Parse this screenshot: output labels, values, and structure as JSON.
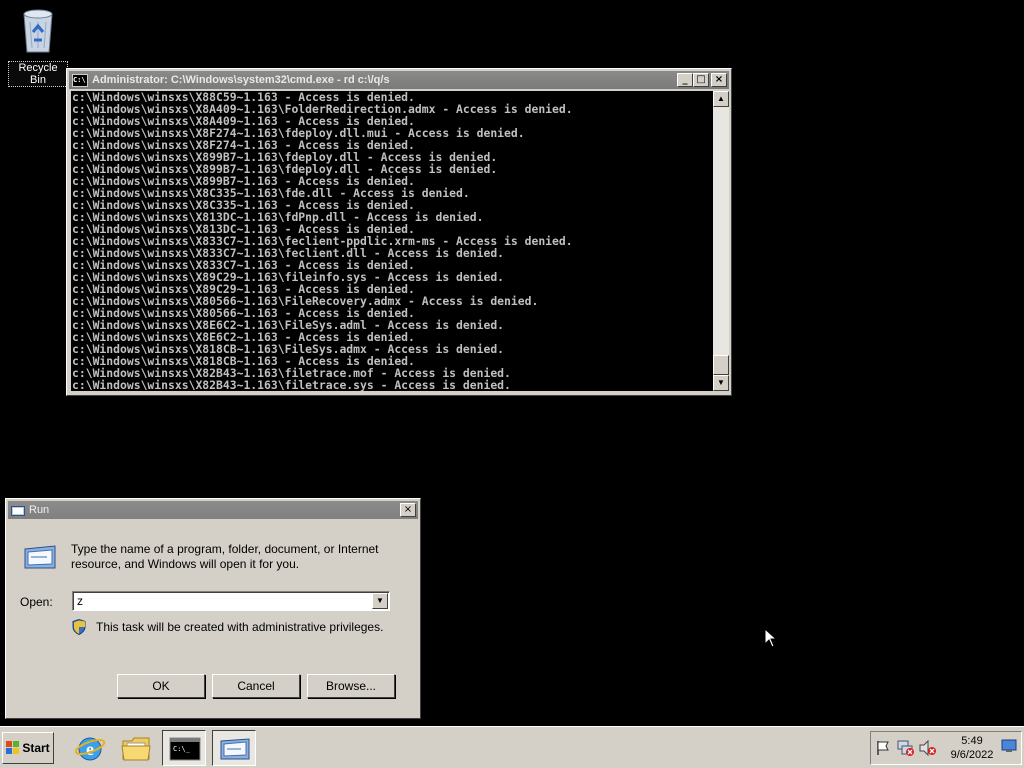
{
  "desktop": {
    "recycle_label": "Recycle Bin"
  },
  "cmd": {
    "title": "Administrator: C:\\Windows\\system32\\cmd.exe - rd  c:\\/q/s",
    "icon_text": "C:\\",
    "lines": [
      "c:\\Windows\\winsxs\\X88C59~1.163 - Access is denied.",
      "c:\\Windows\\winsxs\\X8A409~1.163\\FolderRedirection.admx - Access is denied.",
      "c:\\Windows\\winsxs\\X8A409~1.163 - Access is denied.",
      "c:\\Windows\\winsxs\\X8F274~1.163\\fdeploy.dll.mui - Access is denied.",
      "c:\\Windows\\winsxs\\X8F274~1.163 - Access is denied.",
      "c:\\Windows\\winsxs\\X899B7~1.163\\fdeploy.dll - Access is denied.",
      "c:\\Windows\\winsxs\\X899B7~1.163\\fdeploy.dll - Access is denied.",
      "c:\\Windows\\winsxs\\X899B7~1.163 - Access is denied.",
      "c:\\Windows\\winsxs\\X8C335~1.163\\fde.dll - Access is denied.",
      "c:\\Windows\\winsxs\\X8C335~1.163 - Access is denied.",
      "c:\\Windows\\winsxs\\X813DC~1.163\\fdPnp.dll - Access is denied.",
      "c:\\Windows\\winsxs\\X813DC~1.163 - Access is denied.",
      "c:\\Windows\\winsxs\\X833C7~1.163\\feclient-ppdlic.xrm-ms - Access is denied.",
      "c:\\Windows\\winsxs\\X833C7~1.163\\feclient.dll - Access is denied.",
      "c:\\Windows\\winsxs\\X833C7~1.163 - Access is denied.",
      "c:\\Windows\\winsxs\\X89C29~1.163\\fileinfo.sys - Access is denied.",
      "c:\\Windows\\winsxs\\X89C29~1.163 - Access is denied.",
      "c:\\Windows\\winsxs\\X80566~1.163\\FileRecovery.admx - Access is denied.",
      "c:\\Windows\\winsxs\\X80566~1.163 - Access is denied.",
      "c:\\Windows\\winsxs\\X8E6C2~1.163\\FileSys.adml - Access is denied.",
      "c:\\Windows\\winsxs\\X8E6C2~1.163 - Access is denied.",
      "c:\\Windows\\winsxs\\X818CB~1.163\\FileSys.admx - Access is denied.",
      "c:\\Windows\\winsxs\\X818CB~1.163 - Access is denied.",
      "c:\\Windows\\winsxs\\X82B43~1.163\\filetrace.mof - Access is denied.",
      "c:\\Windows\\winsxs\\X82B43~1.163\\filetrace.sys - Access is denied."
    ]
  },
  "run": {
    "title": "Run",
    "description": "Type the name of a program, folder, document, or Internet resource, and Windows will open it for you.",
    "open_label": "Open:",
    "open_value": "z",
    "admin_note": "This task will be created with administrative privileges.",
    "ok_label": "OK",
    "cancel_label": "Cancel",
    "browse_label": "Browse..."
  },
  "taskbar": {
    "start_label": "Start",
    "time": "5:49",
    "date": "9/6/2022"
  },
  "icons": {
    "close": "×",
    "minimize": "_",
    "maximize": "□",
    "scroll_up": "▲",
    "scroll_down": "▼",
    "combo_drop": "▼"
  }
}
